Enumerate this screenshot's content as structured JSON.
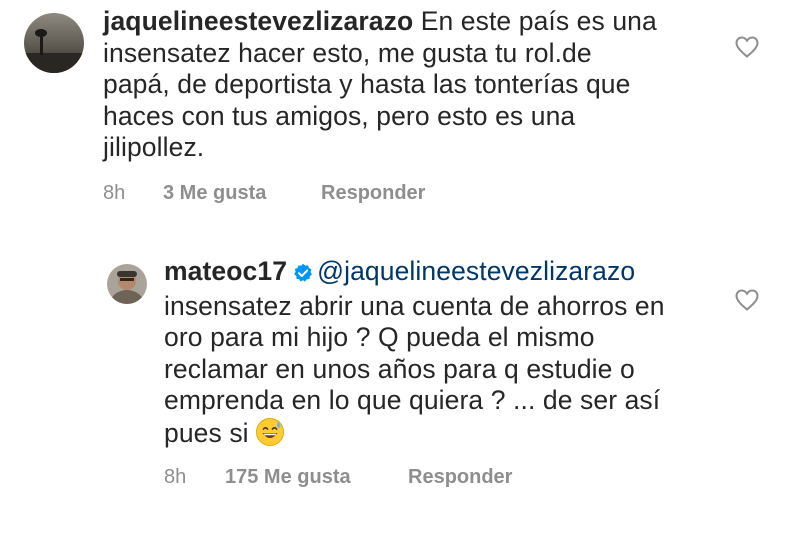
{
  "comment1": {
    "username": "jaquelineestevezlizarazo",
    "text_line1": "En este país es una",
    "text_lines": [
      "insensatez hacer esto, me gusta tu rol.de",
      "papá, de deportista y hasta las tonterías que",
      "haces con tus amigos, pero esto es una",
      "jilipollez."
    ],
    "time": "8h",
    "likes": "3 Me gusta",
    "reply": "Responder",
    "like_icon": "heart-outline-icon"
  },
  "comment2": {
    "username": "mateoc17",
    "verified_icon": "verified-badge-icon",
    "mention": "@jaquelineestevezlizarazo",
    "text_lines": [
      "insensatez abrir una cuenta de ahorros en",
      "oro para mi hijo ? Q pueda el mismo",
      "reclamar en unos años para q estudie o",
      "emprenda en lo que quiera ? ... de ser así"
    ],
    "last_line": "pues si",
    "emoji": "grinning-face-with-sweat-emoji",
    "time": "8h",
    "likes": "175 Me gusta",
    "reply": "Responder",
    "like_icon": "heart-outline-icon"
  },
  "colors": {
    "text": "#262626",
    "secondary": "#8e8e8e",
    "mention": "#00376b",
    "verified": "#0095f6"
  }
}
